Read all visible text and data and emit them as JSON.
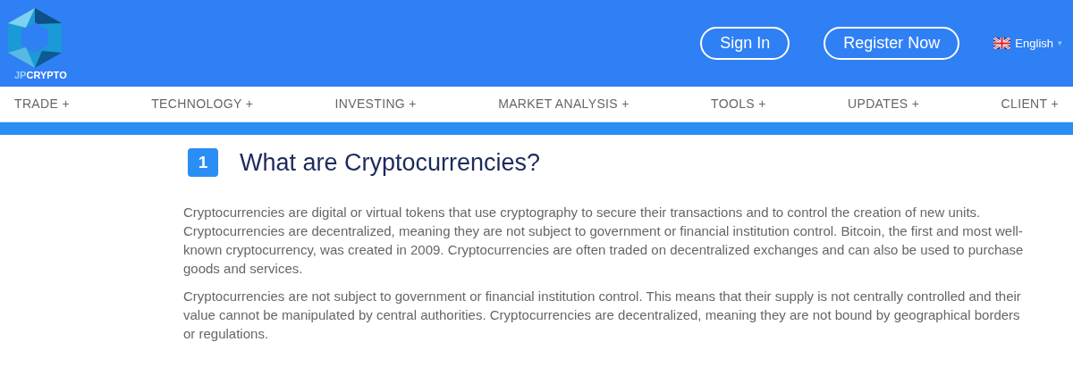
{
  "header": {
    "logo": {
      "parts": [
        "JP",
        "CRYPTO"
      ]
    },
    "buttons": [
      "Sign In",
      "Register Now"
    ],
    "language": {
      "label": "English",
      "caret": "▾"
    }
  },
  "nav": [
    "TRADE +",
    "TECHNOLOGY +",
    "INVESTING +",
    "MARKET ANALYSIS +",
    "TOOLS +",
    "UPDATES +",
    "CLIENT +"
  ],
  "section": {
    "number": "1",
    "title": "What are Cryptocurrencies?",
    "paragraphs": [
      "Cryptocurrencies are digital or virtual tokens that use cryptography to secure their transactions and to control the creation of new units. Cryptocurrencies are decentralized, meaning they are not subject to government or financial institution control. Bitcoin, the first and most well-known cryptocurrency, was created in 2009. Cryptocurrencies are often traded on decentralized exchanges and can also be used to purchase goods and services.",
      "Cryptocurrencies are not subject to government or financial institution control. This means that their supply is not centrally controlled and their value cannot be manipulated by central authorities. Cryptocurrencies are decentralized, meaning they are not bound by geographical borders or regulations."
    ]
  }
}
